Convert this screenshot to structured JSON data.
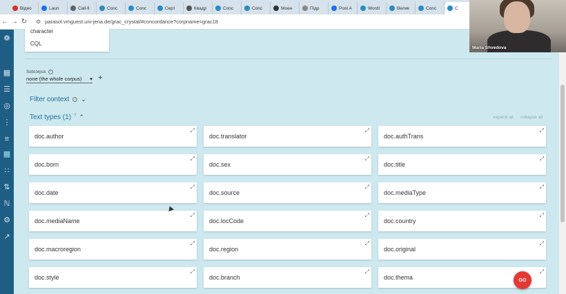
{
  "browser": {
    "tabs": [
      {
        "label": "Відео",
        "color": "#d93025"
      },
      {
        "label": "Laun",
        "color": "#1a73e8"
      },
      {
        "label": "Call-fi",
        "color": "#5f6368"
      },
      {
        "label": "Conc",
        "color": "#2a8cc2"
      },
      {
        "label": "Conc",
        "color": "#2a8cc2"
      },
      {
        "label": "Серт",
        "color": "#2a8cc2"
      },
      {
        "label": "Квадр",
        "color": "#555555"
      },
      {
        "label": "Conc",
        "color": "#2a8cc2"
      },
      {
        "label": "Conc",
        "color": "#2a8cc2"
      },
      {
        "label": "Моен",
        "color": "#333333"
      },
      {
        "label": "Підр",
        "color": "#888888"
      },
      {
        "label": "Post A",
        "color": "#1a73e8"
      },
      {
        "label": "WordI",
        "color": "#2a8cc2"
      },
      {
        "label": "Велик",
        "color": "#2a8cc2"
      },
      {
        "label": "Conc",
        "color": "#2a8cc2"
      },
      {
        "label": "C",
        "color": "#2a8cc2"
      }
    ],
    "url": "parasol.vmguest.uni-jena.de/grac_crystal/#concordance?corpname=grac18"
  },
  "query_options": [
    "character",
    "CQL"
  ],
  "subcorpus": {
    "label": "Subcorpus",
    "value": "none (the whole corpus)"
  },
  "filter_context": {
    "label": "Filter context"
  },
  "text_types": {
    "label": "Text types (1)",
    "superscript": "?",
    "expand_all": "expand all",
    "collapse_all": "collapse all",
    "items": [
      "doc.author",
      "doc.translator",
      "doc.authTrans",
      "doc.born",
      "doc.sex",
      "doc.title",
      "doc.date",
      "doc.source",
      "doc.mediaType",
      "doc.mediaName",
      "doc.locCode",
      "doc.country",
      "doc.macroregion",
      "doc.region",
      "doc.original",
      "doc.style",
      "doc.branch",
      "doc.thema"
    ]
  },
  "go_button": {
    "label": "GO",
    "color": "#e53935"
  },
  "webcam": {
    "name": "Maria Shvedova"
  },
  "colors": {
    "sidebar": "#1f5e84",
    "content_bg": "#cde9ef",
    "accent": "#1f6f99"
  }
}
